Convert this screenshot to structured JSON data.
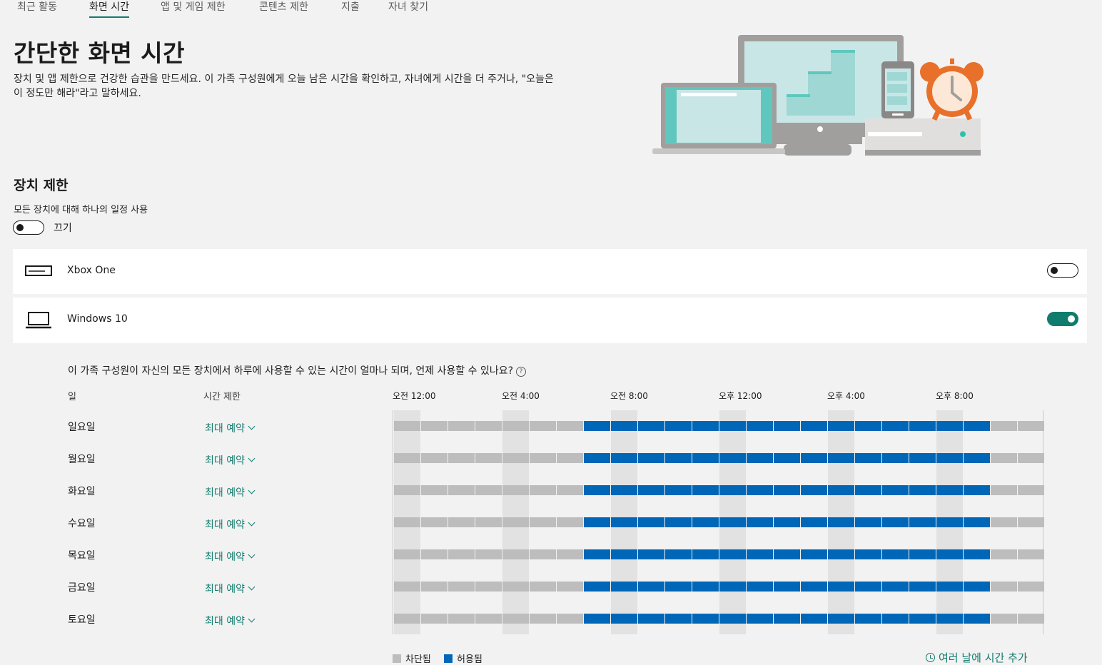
{
  "tabs": [
    {
      "label": "최근 활동",
      "active": false
    },
    {
      "label": "화면 시간",
      "active": true
    },
    {
      "label": "앱 및 게임 제한",
      "active": false
    },
    {
      "label": "콘텐츠 제한",
      "active": false
    },
    {
      "label": "지출",
      "active": false
    },
    {
      "label": "자녀 찾기",
      "active": false
    }
  ],
  "header": {
    "title": "간단한 화면 시간",
    "description": "장치 및 앱 제한으로 건강한 습관을 만드세요. 이 가족 구성원에게 오늘 남은 시간을 확인하고, 자녀에게 시간을 더 주거나, \"오늘은 이 정도만 해라\"라고 말하세요."
  },
  "device_limits": {
    "title": "장치 제한",
    "subtitle": "모든 장치에 대해 하나의 일정 사용",
    "toggle_label": "끄기",
    "toggle_on": false
  },
  "devices": [
    {
      "name": "Xbox One",
      "icon": "xbox-console-icon",
      "enabled": false
    },
    {
      "name": "Windows 10",
      "icon": "laptop-icon",
      "enabled": true
    }
  ],
  "schedule": {
    "question": "이 가족 구성원이 자신의 모든 장치에서 하루에 사용할 수 있는 시간이 얼마나 되며, 언제 사용할 수 있나요?",
    "col_day": "일",
    "col_limit": "시간 제한",
    "hour_labels": [
      "오전 12:00",
      "오전 4:00",
      "오전 8:00",
      "오후 12:00",
      "오후 4:00",
      "오후 8:00"
    ],
    "days": [
      {
        "label": "일요일",
        "limit": "최대 예약"
      },
      {
        "label": "월요일",
        "limit": "최대 예약"
      },
      {
        "label": "화요일",
        "limit": "최대 예약"
      },
      {
        "label": "수요일",
        "limit": "최대 예약"
      },
      {
        "label": "목요일",
        "limit": "최대 예약"
      },
      {
        "label": "금요일",
        "limit": "최대 예약"
      },
      {
        "label": "토요일",
        "limit": "최대 예약"
      }
    ],
    "allowed_from_hour": 7,
    "allowed_to_hour": 22,
    "legend_blocked": "차단됨",
    "legend_allowed": "허용됨",
    "add_time_label": "여러 날에 시간 추가"
  },
  "colors": {
    "accent": "#107c6e",
    "allowed": "#0067b8",
    "blocked": "#bdbdbd"
  }
}
